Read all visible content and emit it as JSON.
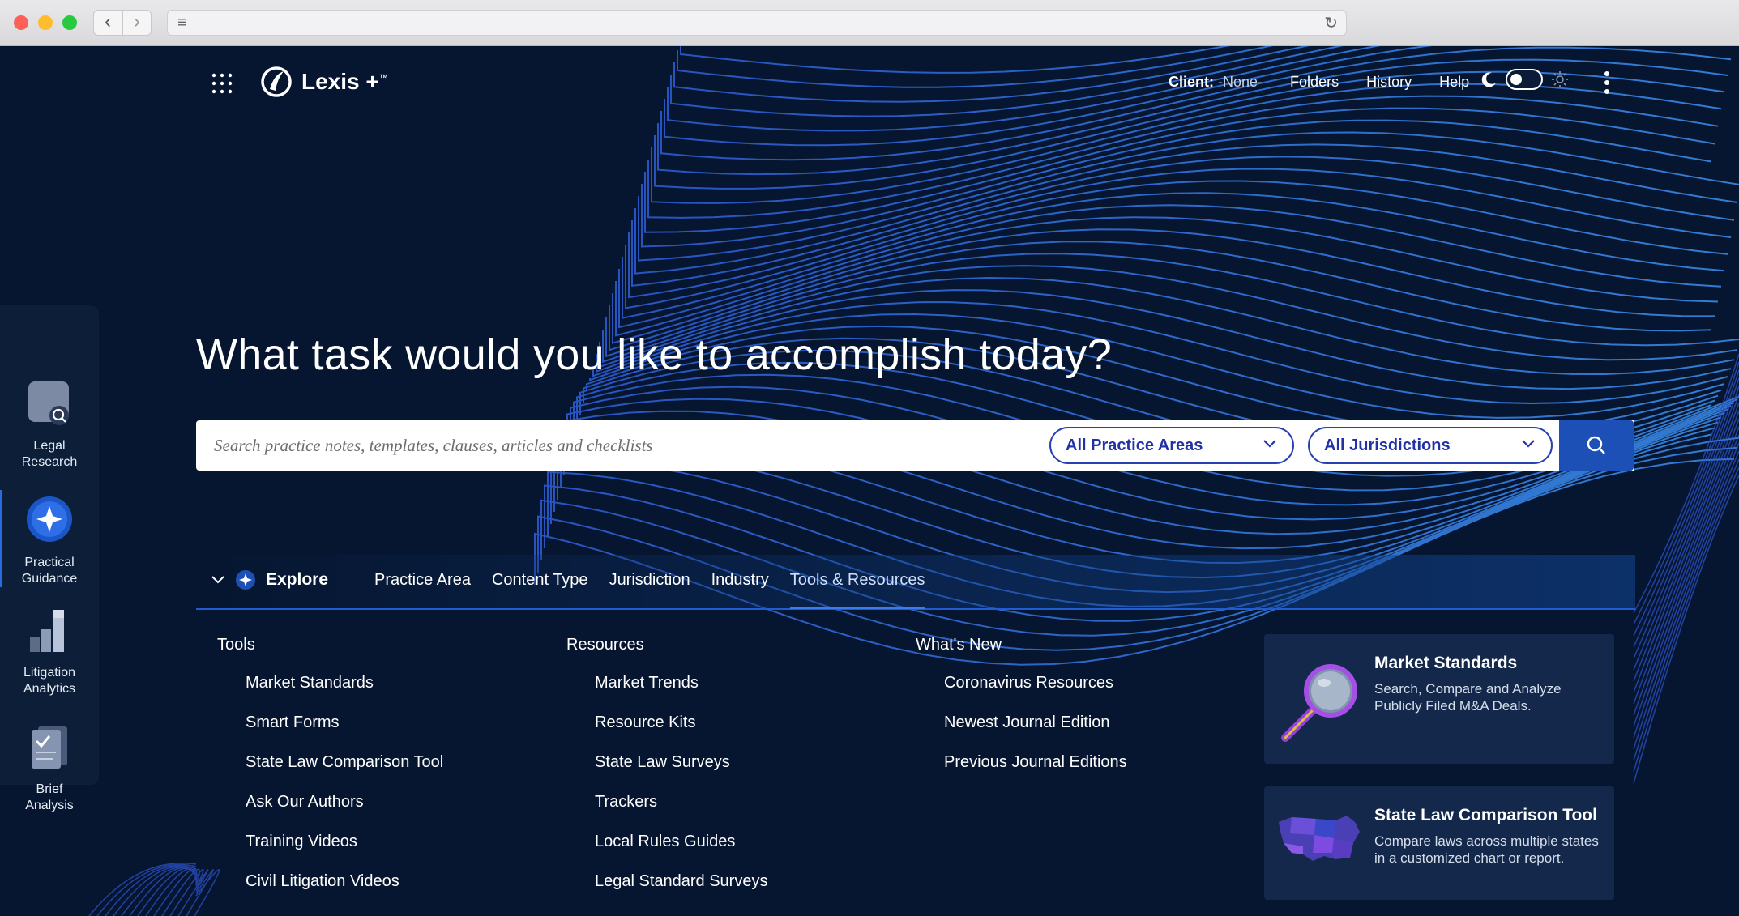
{
  "topnav": {
    "brand": "Lexis +",
    "brand_tm": "™",
    "client_label": "Client:",
    "client_value": "-None-",
    "links": [
      "Folders",
      "History",
      "Help"
    ]
  },
  "rail": [
    {
      "label_1": "Legal",
      "label_2": "Research",
      "icon": "legal-research-icon"
    },
    {
      "label_1": "Practical",
      "label_2": "Guidance",
      "icon": "practical-guidance-icon"
    },
    {
      "label_1": "Litigation",
      "label_2": "Analytics",
      "icon": "litigation-analytics-icon"
    },
    {
      "label_1": "Brief",
      "label_2": "Analysis",
      "icon": "brief-analysis-icon"
    }
  ],
  "hero": {
    "title": "What task would you like to accomplish today?",
    "search_placeholder": "Search practice notes, templates, clauses, articles and checklists",
    "practice_areas": "All Practice Areas",
    "jurisdictions": "All Jurisdictions"
  },
  "explore": {
    "label": "Explore",
    "tabs": [
      "Practice Area",
      "Content Type",
      "Jurisdiction",
      "Industry",
      "Tools & Resources"
    ],
    "active_tab": "Tools & Resources"
  },
  "columns": {
    "tools": {
      "heading": "Tools",
      "items": [
        "Market Standards",
        "Smart Forms",
        "State Law Comparison Tool",
        "Ask Our Authors",
        "Training Videos",
        "Civil Litigation Videos"
      ]
    },
    "resources": {
      "heading": "Resources",
      "items": [
        "Market Trends",
        "Resource Kits",
        "State Law Surveys",
        "Trackers",
        "Local Rules Guides",
        "Legal Standard Surveys"
      ]
    },
    "whatsnew": {
      "heading": "What's New",
      "items": [
        "Coronavirus Resources",
        "Newest Journal Edition",
        "Previous Journal Editions"
      ]
    }
  },
  "cards": {
    "market_standards": {
      "title": "Market Standards",
      "desc": "Search, Compare and Analyze Publicly Filed M&A Deals."
    },
    "state_law": {
      "title": "State Law Comparison Tool",
      "desc": "Compare laws across multiple states in a customized chart or report."
    }
  },
  "colors": {
    "background": "#061630",
    "accent": "#1d50b6",
    "pill": "#2232a6"
  }
}
